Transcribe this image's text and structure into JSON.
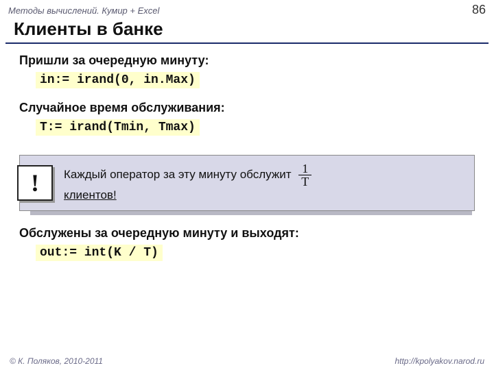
{
  "header": {
    "course": "Методы вычислений. Кумир + Excel",
    "page_number": "86"
  },
  "title": "Клиенты в банке",
  "sections": {
    "arrive": {
      "label": "Пришли за очередную минуту:",
      "code": "in:= irand(0, in.Max)"
    },
    "service_time": {
      "label": "Случайное время обслуживания:",
      "code": "T:= irand(Tmin, Tmax)"
    },
    "callout": {
      "bang": "!",
      "text_prefix": "Каждый оператор за эту минуту обслужит ",
      "text_suffix": "клиентов!",
      "fraction": {
        "num": "1",
        "den": "T"
      }
    },
    "served": {
      "label": "Обслужены за очередную минуту и выходят:",
      "code": "out:= int(K / T)"
    }
  },
  "footer": {
    "copyright": "© К. Поляков, 2010-2011",
    "url": "http://kpolyakov.narod.ru"
  }
}
